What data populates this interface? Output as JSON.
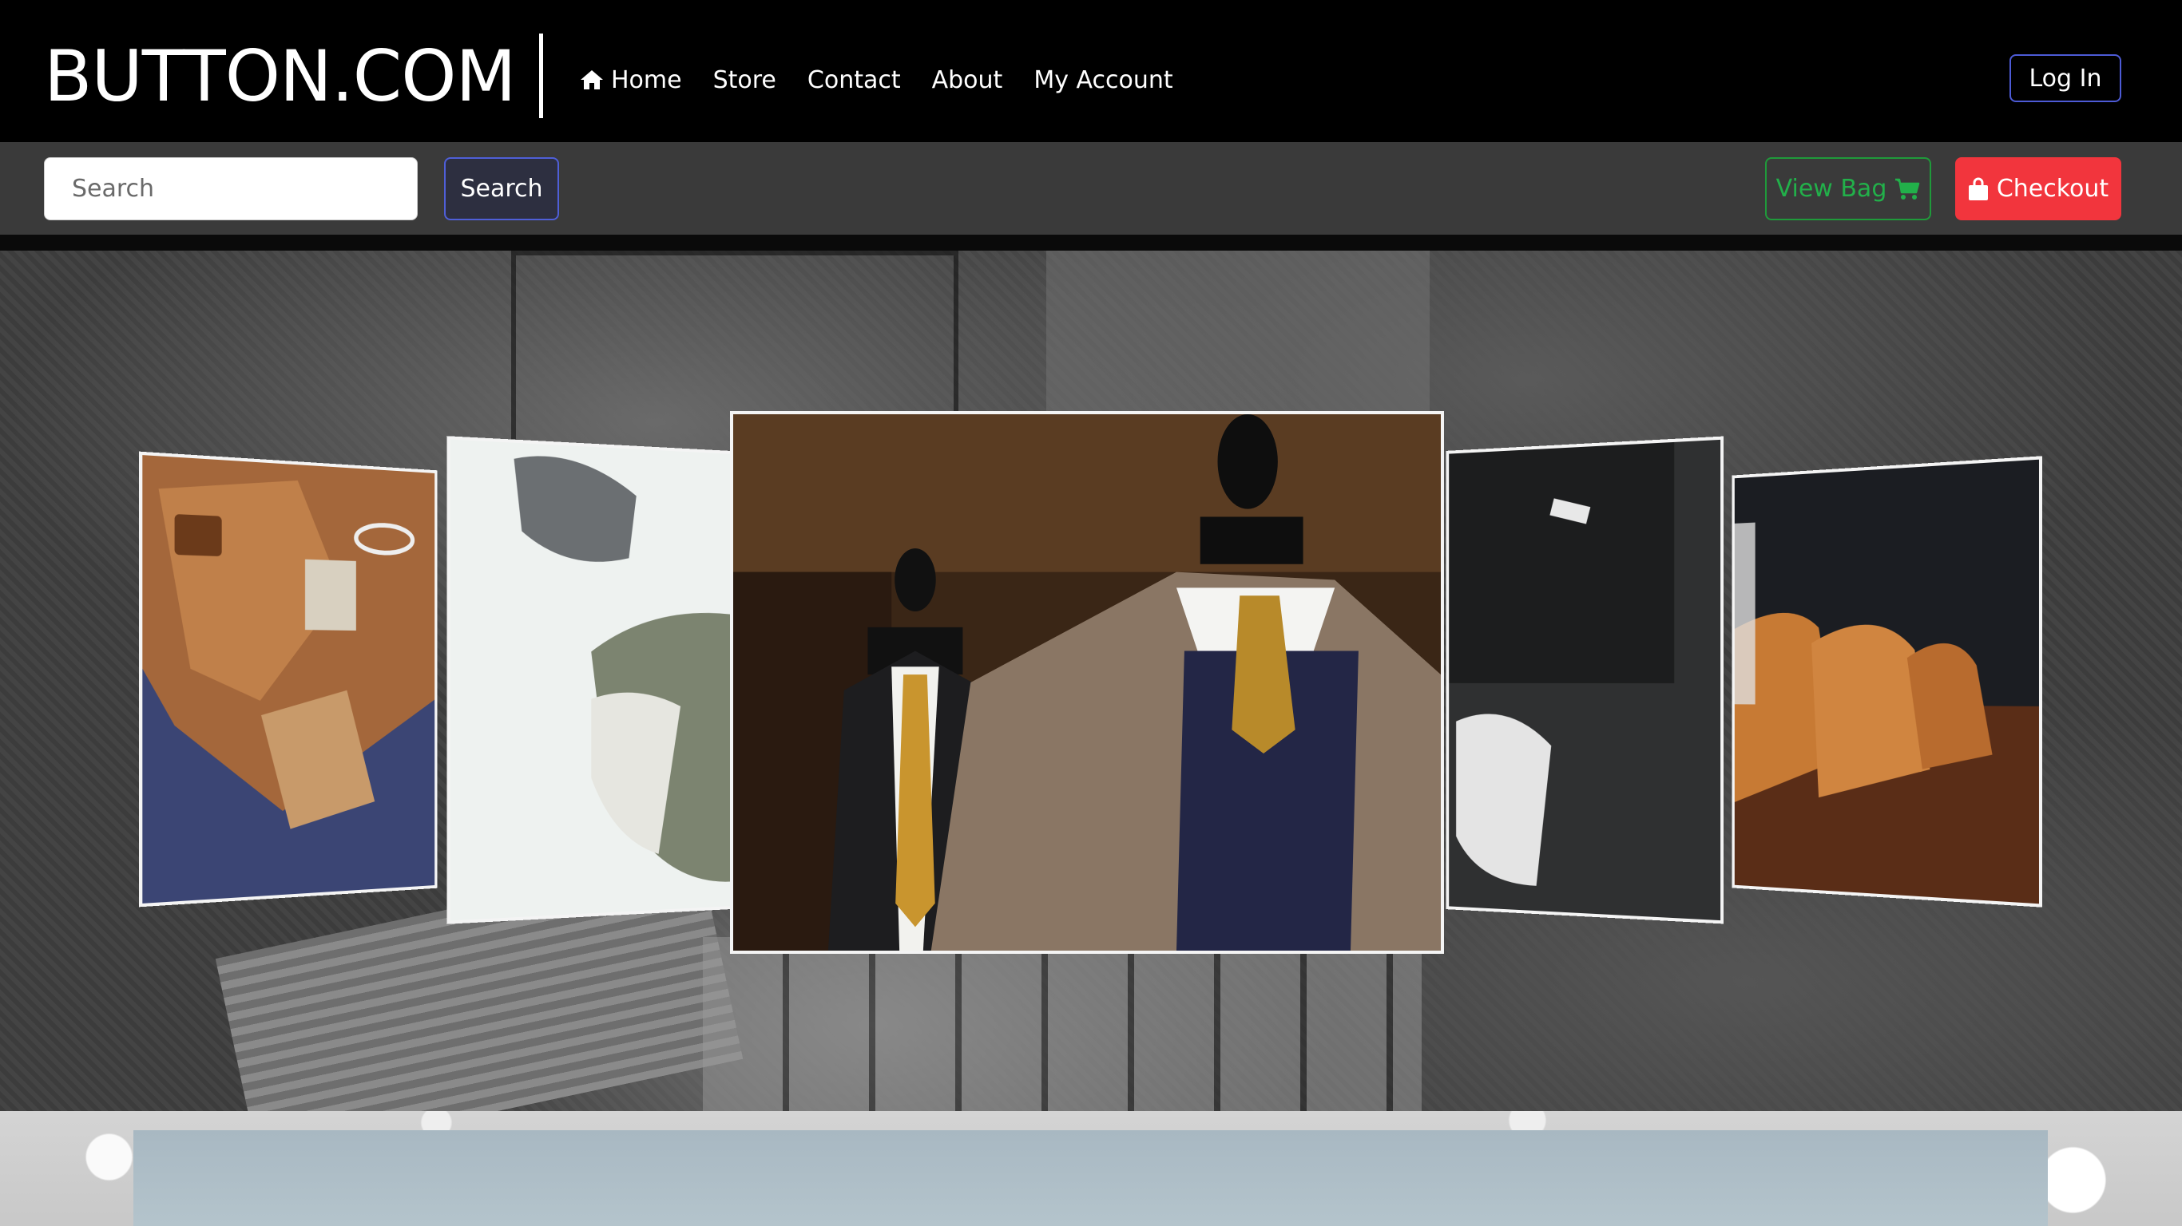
{
  "brand": {
    "name": "BUTTON.COM"
  },
  "nav": {
    "items": [
      {
        "label": "Home",
        "icon": "home-icon"
      },
      {
        "label": "Store"
      },
      {
        "label": "Contact"
      },
      {
        "label": "About"
      },
      {
        "label": "My Account"
      }
    ],
    "login_label": "Log In"
  },
  "toolbar": {
    "search_placeholder": "Search",
    "search_label": "Search",
    "bag_label": "View Bag",
    "bag_icon": "cart-icon",
    "checkout_label": "Checkout",
    "checkout_icon": "shopping-bag-icon"
  },
  "carousel": {
    "slides": [
      {
        "subject": "leather-bag-and-accessories"
      },
      {
        "subject": "sneaker-and-scarf"
      },
      {
        "subject": "mannequins-in-suits"
      },
      {
        "subject": "black-shirt-and-white-sneakers"
      },
      {
        "subject": "brown-leather-shoes"
      }
    ],
    "active_index": 2
  },
  "colors": {
    "navbar_bg": "#000000",
    "toolbar_bg": "#3a3a3a",
    "primary_outline": "#4d5bd6",
    "success": "#22b04a",
    "danger": "#f2353d"
  }
}
